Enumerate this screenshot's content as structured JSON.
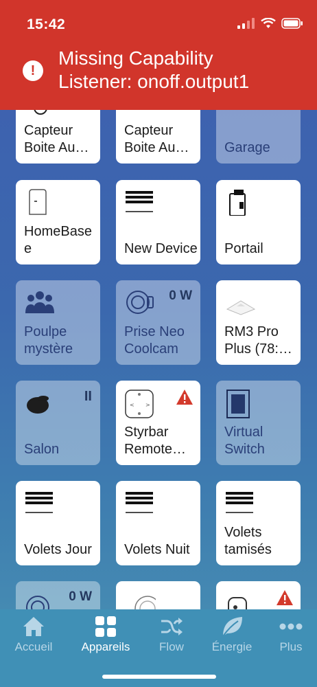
{
  "status_bar": {
    "time": "15:42"
  },
  "banner": {
    "message_line1": "Missing Capability",
    "message_line2": "Listener: onoff.output1",
    "background": "#d1352b"
  },
  "devices": [
    {
      "name": "Capteur Boite Au…",
      "state": "on"
    },
    {
      "name": "Capteur Boite Au…",
      "state": "on"
    },
    {
      "name": "Garage",
      "state": "off"
    },
    {
      "name": "HomeBase e",
      "state": "on",
      "icon": "homebase-icon"
    },
    {
      "name": "New Device",
      "state": "on",
      "icon": "blinds-icon"
    },
    {
      "name": "Portail",
      "state": "on",
      "icon": "remote-icon"
    },
    {
      "name": "Poulpe mystère",
      "state": "off",
      "icon": "people-icon"
    },
    {
      "name": "Prise Neo Coolcam",
      "state": "off",
      "icon": "plug-icon",
      "badge": "0 W"
    },
    {
      "name": "RM3 Pro Plus (78:…",
      "state": "on",
      "icon": "ir-hub-icon"
    },
    {
      "name": "Salon",
      "state": "off",
      "icon": "speaker-icon",
      "badge": "II"
    },
    {
      "name": "Styrbar Remote…",
      "state": "on",
      "icon": "styrbar-icon",
      "warning": true
    },
    {
      "name": "Virtual Switch",
      "state": "off",
      "icon": "switch-icon"
    },
    {
      "name": "Volets Jour",
      "state": "on",
      "icon": "blinds-icon"
    },
    {
      "name": "Volets Nuit",
      "state": "on",
      "icon": "blinds-icon"
    },
    {
      "name": "Volets tamisés",
      "state": "on",
      "icon": "blinds-icon"
    },
    {
      "name": "",
      "state": "off",
      "icon": "plug-icon",
      "badge": "0 W"
    },
    {
      "name": "",
      "state": "on",
      "icon": "sensor-icon"
    },
    {
      "name": "",
      "state": "on",
      "icon": "motion-icon",
      "warning": true
    }
  ],
  "tabbar": {
    "tabs": [
      {
        "label": "Accueil",
        "icon": "home-icon"
      },
      {
        "label": "Appareils",
        "icon": "grid-icon",
        "active": true
      },
      {
        "label": "Flow",
        "icon": "shuffle-icon"
      },
      {
        "label": "Énergie",
        "icon": "leaf-icon"
      },
      {
        "label": "Plus",
        "icon": "dots-icon"
      }
    ]
  }
}
